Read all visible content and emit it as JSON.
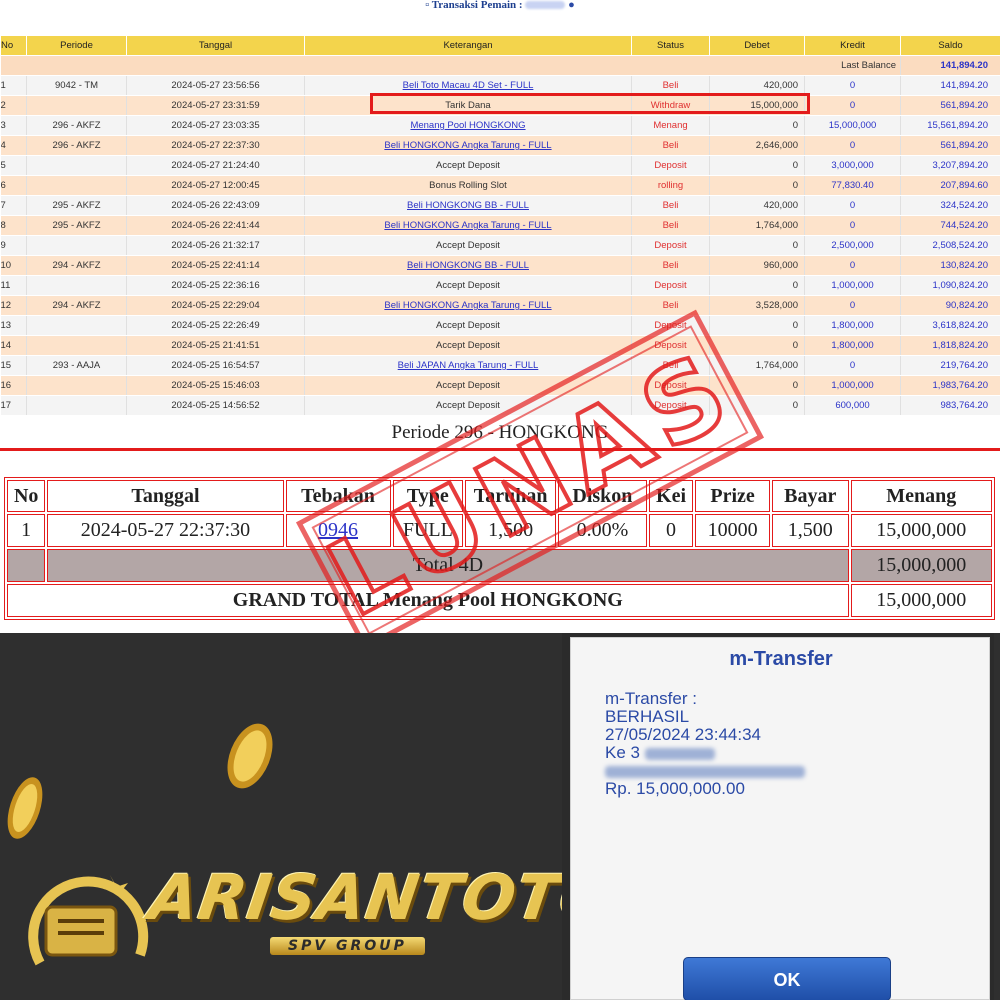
{
  "header": {
    "caption_prefix": "Transaksi",
    "caption_label": "Pemain :"
  },
  "transactions": {
    "columns": [
      "No",
      "Periode",
      "Tanggal",
      "Keterangan",
      "Status",
      "Debet",
      "Kredit",
      "Saldo"
    ],
    "last_balance_label": "Last Balance",
    "last_balance_value": "141,894.20",
    "rows": [
      {
        "no": "1",
        "periode": "9042 - TM",
        "tanggal": "2024-05-27 23:56:56",
        "keterangan": "Beli Toto Macau 4D Set - FULL",
        "link": true,
        "status": "Beli",
        "debet": "420,000",
        "kredit": "0",
        "saldo": "141,894.20"
      },
      {
        "no": "2",
        "periode": "",
        "tanggal": "2024-05-27 23:31:59",
        "keterangan": "Tarik Dana",
        "link": false,
        "status": "Withdraw",
        "debet": "15,000,000",
        "kredit": "0",
        "saldo": "561,894.20"
      },
      {
        "no": "3",
        "periode": "296 - AKFZ",
        "tanggal": "2024-05-27 23:03:35",
        "keterangan": "Menang Pool HONGKONG",
        "link": true,
        "status": "Menang",
        "debet": "0",
        "kredit": "15,000,000",
        "saldo": "15,561,894.20"
      },
      {
        "no": "4",
        "periode": "296 - AKFZ",
        "tanggal": "2024-05-27 22:37:30",
        "keterangan": "Beli HONGKONG Angka Tarung - FULL",
        "link": true,
        "status": "Beli",
        "debet": "2,646,000",
        "kredit": "0",
        "saldo": "561,894.20"
      },
      {
        "no": "5",
        "periode": "",
        "tanggal": "2024-05-27 21:24:40",
        "keterangan": "Accept Deposit",
        "link": false,
        "status": "Deposit",
        "debet": "0",
        "kredit": "3,000,000",
        "saldo": "3,207,894.20"
      },
      {
        "no": "6",
        "periode": "",
        "tanggal": "2024-05-27 12:00:45",
        "keterangan": "Bonus Rolling Slot",
        "link": false,
        "status": "rolling",
        "debet": "0",
        "kredit": "77,830.40",
        "saldo": "207,894.60"
      },
      {
        "no": "7",
        "periode": "295 - AKFZ",
        "tanggal": "2024-05-26 22:43:09",
        "keterangan": "Beli HONGKONG BB - FULL",
        "link": true,
        "status": "Beli",
        "debet": "420,000",
        "kredit": "0",
        "saldo": "324,524.20"
      },
      {
        "no": "8",
        "periode": "295 - AKFZ",
        "tanggal": "2024-05-26 22:41:44",
        "keterangan": "Beli HONGKONG Angka Tarung - FULL",
        "link": true,
        "status": "Beli",
        "debet": "1,764,000",
        "kredit": "0",
        "saldo": "744,524.20"
      },
      {
        "no": "9",
        "periode": "",
        "tanggal": "2024-05-26 21:32:17",
        "keterangan": "Accept Deposit",
        "link": false,
        "status": "Deposit",
        "debet": "0",
        "kredit": "2,500,000",
        "saldo": "2,508,524.20"
      },
      {
        "no": "10",
        "periode": "294 - AKFZ",
        "tanggal": "2024-05-25 22:41:14",
        "keterangan": "Beli HONGKONG BB - FULL",
        "link": true,
        "status": "Beli",
        "debet": "960,000",
        "kredit": "0",
        "saldo": "130,824.20"
      },
      {
        "no": "11",
        "periode": "",
        "tanggal": "2024-05-25 22:36:16",
        "keterangan": "Accept Deposit",
        "link": false,
        "status": "Deposit",
        "debet": "0",
        "kredit": "1,000,000",
        "saldo": "1,090,824.20"
      },
      {
        "no": "12",
        "periode": "294 - AKFZ",
        "tanggal": "2024-05-25 22:29:04",
        "keterangan": "Beli HONGKONG Angka Tarung - FULL",
        "link": true,
        "status": "Beli",
        "debet": "3,528,000",
        "kredit": "0",
        "saldo": "90,824.20"
      },
      {
        "no": "13",
        "periode": "",
        "tanggal": "2024-05-25 22:26:49",
        "keterangan": "Accept Deposit",
        "link": false,
        "status": "Deposit",
        "debet": "0",
        "kredit": "1,800,000",
        "saldo": "3,618,824.20"
      },
      {
        "no": "14",
        "periode": "",
        "tanggal": "2024-05-25 21:41:51",
        "keterangan": "Accept Deposit",
        "link": false,
        "status": "Deposit",
        "debet": "0",
        "kredit": "1,800,000",
        "saldo": "1,818,824.20"
      },
      {
        "no": "15",
        "periode": "293 - AAJA",
        "tanggal": "2024-05-25 16:54:57",
        "keterangan": "Beli JAPAN Angka Tarung - FULL",
        "link": true,
        "status": "Beli",
        "debet": "1,764,000",
        "kredit": "0",
        "saldo": "219,764.20"
      },
      {
        "no": "16",
        "periode": "",
        "tanggal": "2024-05-25 15:46:03",
        "keterangan": "Accept Deposit",
        "link": false,
        "status": "Deposit",
        "debet": "0",
        "kredit": "1,000,000",
        "saldo": "1,983,764.20"
      },
      {
        "no": "17",
        "periode": "",
        "tanggal": "2024-05-25 14:56:52",
        "keterangan": "Accept Deposit",
        "link": false,
        "status": "Deposit",
        "debet": "0",
        "kredit": "600,000",
        "saldo": "983,764.20"
      }
    ]
  },
  "periode": {
    "title": "Periode 296 - HONGKONG",
    "columns": [
      "No",
      "Tanggal",
      "Tebakan",
      "Type",
      "Taruhan",
      "Diskon",
      "Kei",
      "Prize",
      "Bayar",
      "Menang"
    ],
    "row": {
      "no": "1",
      "tanggal": "2024-05-27 22:37:30",
      "tebakan": "0946",
      "type": "FULL",
      "taruhan": "1,500",
      "diskon": "0.00%",
      "kei": "0",
      "prize": "10000",
      "bayar": "1,500",
      "menang": "15,000,000"
    },
    "total_label": "Total 4D",
    "total_value": "15,000,000",
    "grand_label": "GRAND TOTAL  Menang Pool HONGKONG",
    "grand_value": "15,000,000",
    "stamp_text": "LUNAS"
  },
  "brand": {
    "logo_text": "ARISANTOTO",
    "logo_sub": "SPV GROUP"
  },
  "transfer": {
    "title": "m-Transfer",
    "line1": "m-Transfer :",
    "line2": "BERHASIL",
    "line3": "27/05/2024 23:44:34",
    "line4_prefix": "Ke 3",
    "line6": "Rp. 15,000,000.00",
    "ok_label": "OK"
  },
  "colors": {
    "header_yellow": "#f3d44c",
    "row_peach": "#fde3cb",
    "accent_red": "#e31b1b",
    "link_blue": "#2b33c8",
    "gold": "#e7c452"
  }
}
